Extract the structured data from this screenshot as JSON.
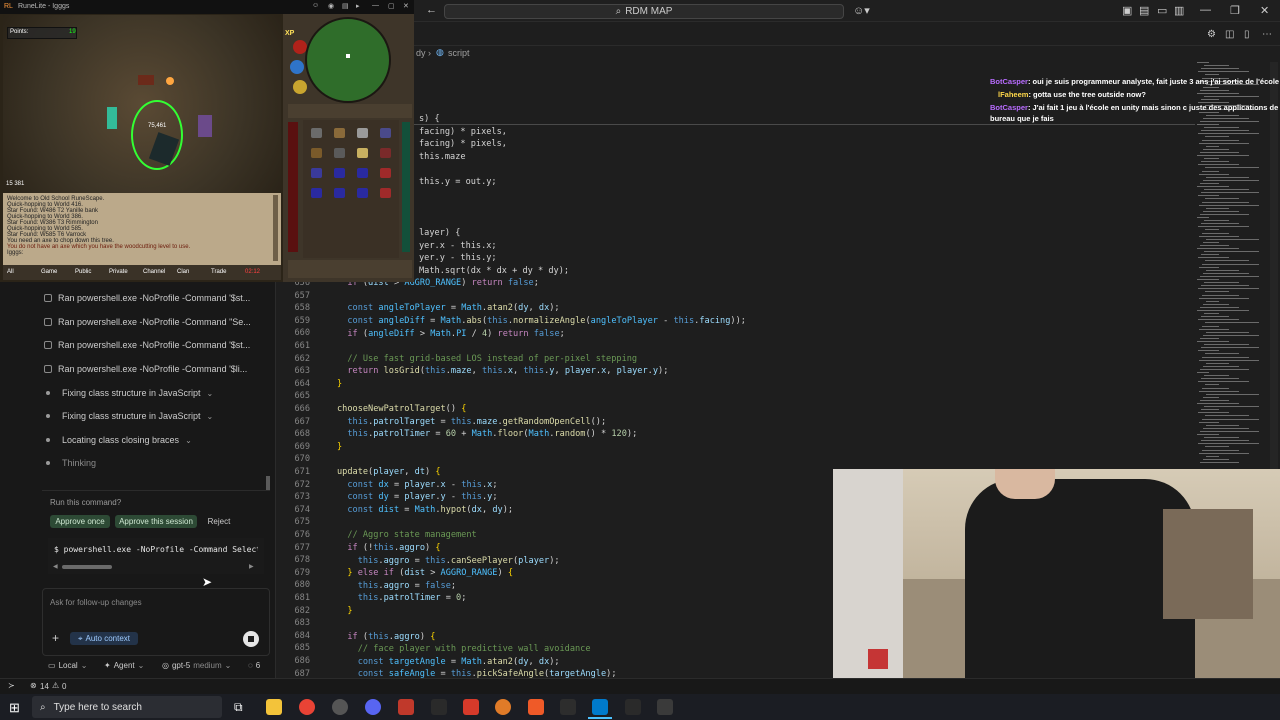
{
  "vscode": {
    "command_center": "RDM MAP",
    "breadcrumb": [
      "dy",
      "script"
    ]
  },
  "sidebar": {
    "activities": [
      "Ran powershell.exe -NoProfile -Command '$st...",
      "Ran powershell.exe -NoProfile -Command \"Se...",
      "Ran powershell.exe -NoProfile -Command '$st...",
      "Ran powershell.exe -NoProfile -Command '$li..."
    ],
    "steps": [
      "Fixing class structure in JavaScript",
      "Fixing class structure in JavaScript",
      "Locating class closing braces"
    ],
    "thinking": "Thinking",
    "prompt": "Run this command?",
    "approve_once": "Approve once",
    "approve_session": "Approve this session",
    "reject": "Reject",
    "command": "$ powershell.exe -NoProfile -Command Select",
    "followup_placeholder": "Ask for follow-up changes",
    "auto_context": "Auto context",
    "mode_local": "Local",
    "mode_agent": "Agent",
    "model": "gpt-5",
    "model_level": "medium",
    "counter": "6"
  },
  "editor": {
    "top_fragments": [
      "s) {",
      "facing) * pixels,",
      "facing) * pixels,",
      "this.maze",
      "this.y = out.y;",
      "layer) {",
      "yer.x - this.x;",
      "yer.y - this.y;",
      "Math.sqrt(dx * dx + dy * dy);"
    ],
    "line_numbers": [
      "656",
      "657",
      "658",
      "659",
      "660",
      "661",
      "662",
      "663",
      "664",
      "665",
      "666",
      "667",
      "668",
      "669",
      "670",
      "671",
      "672",
      "673",
      "674",
      "675",
      "676",
      "677",
      "678",
      "679",
      "680",
      "681",
      "682",
      "683",
      "684",
      "685",
      "686",
      "687"
    ]
  },
  "chat_overlay": [
    {
      "user": "BotCasper",
      "message": ": oui je suis programmeur analyste, fait juste 3 ans j'ai sortie de l'école",
      "color": "#b86cff"
    },
    {
      "user": "lFaheem",
      "message": ": gotta use the tree outside now?",
      "color": "#ffd84a"
    },
    {
      "user": "BotCasper",
      "message": ": J'ai fait 1 jeu à l'école en unity mais sinon c juste des applications de",
      "color": "#b86cff"
    },
    {
      "user": "",
      "message": "bureau que je fais",
      "color": "#ffffff"
    }
  ],
  "game": {
    "title": "RuneLite - Igggs",
    "points_label": "Points:",
    "points_value": "19",
    "target_hp": "75,461",
    "world_label": "15 381",
    "chat_lines": [
      "Welcome to Old School RuneScape.",
      "Quick-hopping to World 416.",
      "Star Found: W486 T2 Yanille bank",
      "Quick-hopping to World 386.",
      "Star Found: W386 T3 Rimmington",
      "Quick-hopping to World 585.",
      "Star Found: W585 T6 Varrock",
      "You need an axe to chop down this tree.",
      "You do not have an axe which you have the woodcutting level to use."
    ],
    "chat_input": "Igggs:",
    "chat_tabs": [
      "All",
      "Game",
      "Public",
      "Private",
      "Channel",
      "Clan",
      "Trade",
      "02:12"
    ],
    "xp_label": "XP",
    "orb_values": [
      "92",
      "72",
      "100"
    ]
  },
  "statusbar": {
    "errors": "14",
    "warnings": "0"
  },
  "taskbar": {
    "search_placeholder": "Type here to search"
  },
  "colors": {
    "accent": "#0078d4",
    "keyword": "#c586c0",
    "function": "#dcdcaa"
  }
}
